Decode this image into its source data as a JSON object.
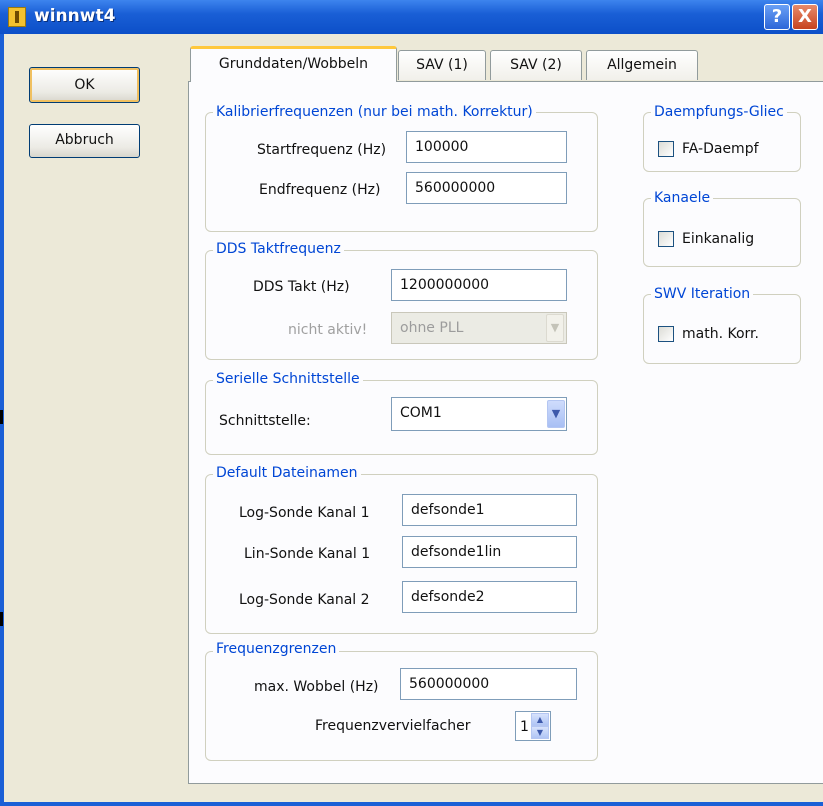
{
  "window": {
    "title": "winnwt4",
    "help_button": "?",
    "close_button": "X"
  },
  "buttons": {
    "ok": "OK",
    "cancel": "Abbruch"
  },
  "tabs": [
    {
      "label": "Grunddaten/Wobbeln",
      "active": true
    },
    {
      "label": "SAV (1)",
      "active": false
    },
    {
      "label": "SAV (2)",
      "active": false
    },
    {
      "label": "Allgemein",
      "active": false
    }
  ],
  "kalibrier": {
    "title": "Kalibrierfrequenzen (nur bei math. Korrektur)",
    "start_label": "Startfrequenz (Hz)",
    "start_value": "100000",
    "end_label": "Endfrequenz (Hz)",
    "end_value": "560000000"
  },
  "dds": {
    "title": "DDS Taktfrequenz",
    "takt_label": "DDS Takt (Hz)",
    "takt_value": "1200000000",
    "pll_label": "nicht aktiv!",
    "pll_value": "ohne PLL"
  },
  "seriell": {
    "title": "Serielle Schnittstelle",
    "port_label": "Schnittstelle:",
    "port_value": "COM1"
  },
  "dateinamen": {
    "title": "Default Dateinamen",
    "log1_label": "Log-Sonde Kanal 1",
    "log1_value": "defsonde1",
    "lin1_label": "Lin-Sonde Kanal 1",
    "lin1_value": "defsonde1lin",
    "log2_label": "Log-Sonde Kanal 2",
    "log2_value": "defsonde2"
  },
  "frequenzgrenzen": {
    "title": "Frequenzgrenzen",
    "max_label": "max. Wobbel (Hz)",
    "max_value": "560000000",
    "mult_label": "Frequenzvervielfacher",
    "mult_value": "1"
  },
  "daempfung": {
    "title": "Daempfungs-Gliec",
    "checkbox_label": "FA-Daempf",
    "checked": false
  },
  "kanaele": {
    "title": "Kanaele",
    "checkbox_label": "Einkanalig",
    "checked": false
  },
  "swv": {
    "title": "SWV Iteration",
    "checkbox_label": "math. Korr.",
    "checked": false
  },
  "colors": {
    "titlebar": "#0c4fc8",
    "group_title": "#0046d5",
    "window_bg": "#ece9d8",
    "panel_bg": "#fcfcfe"
  }
}
